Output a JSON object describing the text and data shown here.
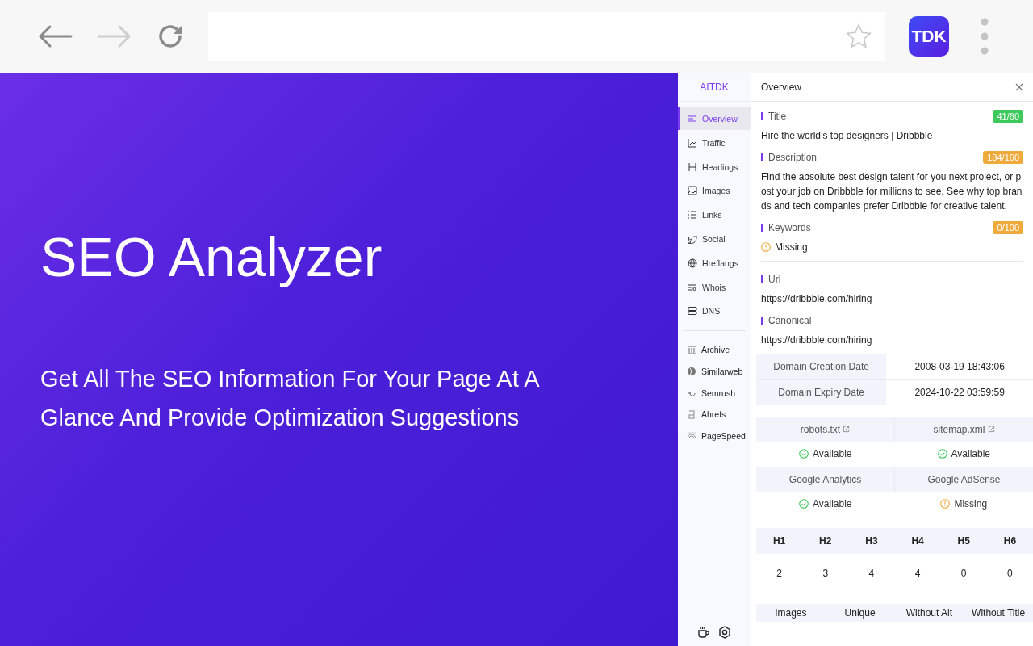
{
  "browser": {
    "extension_badge": "TDK"
  },
  "hero": {
    "title": "SEO Analyzer",
    "subtitle": "Get All The SEO Information For Your Page At A Glance And Provide Optimization Suggestions"
  },
  "panel": {
    "brand": "AITDK",
    "title": "Overview",
    "nav": [
      {
        "label": "Overview",
        "selected": true
      },
      {
        "label": "Traffic",
        "selected": false
      },
      {
        "label": "Headings",
        "selected": false
      },
      {
        "label": "Images",
        "selected": false
      },
      {
        "label": "Links",
        "selected": false
      },
      {
        "label": "Social",
        "selected": false
      },
      {
        "label": "Hreflangs",
        "selected": false
      },
      {
        "label": "Whois",
        "selected": false
      },
      {
        "label": "DNS",
        "selected": false
      }
    ],
    "tools": [
      {
        "label": "Archive"
      },
      {
        "label": "Similarweb"
      },
      {
        "label": "Semrush"
      },
      {
        "label": "Ahrefs"
      },
      {
        "label": "PageSpeed"
      }
    ],
    "sections": [
      {
        "label": "Title",
        "badge": "41/60",
        "color": "#3ec95c",
        "kind": "text",
        "value": "Hire the world’s top designers | Dribbble"
      },
      {
        "label": "Description",
        "badge": "184/160",
        "color": "#f0a93b",
        "kind": "text",
        "value": "Find the absolute best design talent for you next project, or post your job on Dribbble for millions to see. See why top brands and tech companies prefer Dribbble for creative talent."
      },
      {
        "label": "Keywords",
        "badge": "0/100",
        "color": "#f0a93b",
        "kind": "missing",
        "value": "Missing"
      }
    ],
    "links": [
      {
        "label": "Url",
        "value": "https://dribbble.com/hiring"
      },
      {
        "label": "Canonical",
        "value": "https://dribbble.com/hiring"
      }
    ],
    "domain": [
      {
        "label": "Domain Creation Date",
        "value": "2008-03-19 18:43:06"
      },
      {
        "label": "Domain Expiry Date",
        "value": "2024-10-22 03:59:59"
      }
    ],
    "checks": [
      {
        "label": "robots.txt",
        "external": true,
        "kind": "available",
        "status": "Available"
      },
      {
        "label": "sitemap.xml",
        "external": true,
        "kind": "available",
        "status": "Available"
      },
      {
        "label": "Google Analytics",
        "external": false,
        "kind": "available",
        "status": "Available"
      },
      {
        "label": "Google AdSense",
        "external": false,
        "kind": "missing",
        "status": "Missing"
      }
    ],
    "headings": {
      "columns": [
        "H1",
        "H2",
        "H3",
        "H4",
        "H5",
        "H6"
      ],
      "values": [
        "2",
        "3",
        "4",
        "4",
        "0",
        "0"
      ]
    },
    "images": {
      "columns": [
        "Images",
        "Unique",
        "Without Alt",
        "Without Title"
      ]
    }
  }
}
